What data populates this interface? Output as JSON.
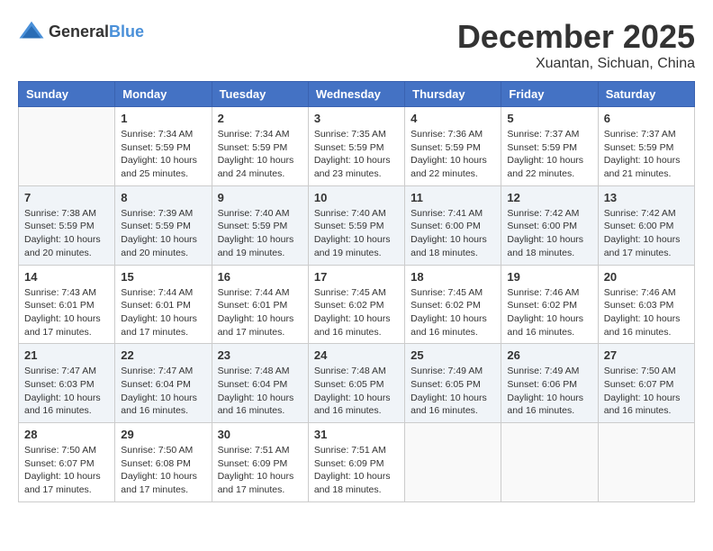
{
  "header": {
    "logo_general": "General",
    "logo_blue": "Blue",
    "month": "December 2025",
    "location": "Xuantan, Sichuan, China"
  },
  "weekdays": [
    "Sunday",
    "Monday",
    "Tuesday",
    "Wednesday",
    "Thursday",
    "Friday",
    "Saturday"
  ],
  "weeks": [
    [
      {
        "day": "",
        "info": ""
      },
      {
        "day": "1",
        "info": "Sunrise: 7:34 AM\nSunset: 5:59 PM\nDaylight: 10 hours\nand 25 minutes."
      },
      {
        "day": "2",
        "info": "Sunrise: 7:34 AM\nSunset: 5:59 PM\nDaylight: 10 hours\nand 24 minutes."
      },
      {
        "day": "3",
        "info": "Sunrise: 7:35 AM\nSunset: 5:59 PM\nDaylight: 10 hours\nand 23 minutes."
      },
      {
        "day": "4",
        "info": "Sunrise: 7:36 AM\nSunset: 5:59 PM\nDaylight: 10 hours\nand 22 minutes."
      },
      {
        "day": "5",
        "info": "Sunrise: 7:37 AM\nSunset: 5:59 PM\nDaylight: 10 hours\nand 22 minutes."
      },
      {
        "day": "6",
        "info": "Sunrise: 7:37 AM\nSunset: 5:59 PM\nDaylight: 10 hours\nand 21 minutes."
      }
    ],
    [
      {
        "day": "7",
        "info": "Sunrise: 7:38 AM\nSunset: 5:59 PM\nDaylight: 10 hours\nand 20 minutes."
      },
      {
        "day": "8",
        "info": "Sunrise: 7:39 AM\nSunset: 5:59 PM\nDaylight: 10 hours\nand 20 minutes."
      },
      {
        "day": "9",
        "info": "Sunrise: 7:40 AM\nSunset: 5:59 PM\nDaylight: 10 hours\nand 19 minutes."
      },
      {
        "day": "10",
        "info": "Sunrise: 7:40 AM\nSunset: 5:59 PM\nDaylight: 10 hours\nand 19 minutes."
      },
      {
        "day": "11",
        "info": "Sunrise: 7:41 AM\nSunset: 6:00 PM\nDaylight: 10 hours\nand 18 minutes."
      },
      {
        "day": "12",
        "info": "Sunrise: 7:42 AM\nSunset: 6:00 PM\nDaylight: 10 hours\nand 18 minutes."
      },
      {
        "day": "13",
        "info": "Sunrise: 7:42 AM\nSunset: 6:00 PM\nDaylight: 10 hours\nand 17 minutes."
      }
    ],
    [
      {
        "day": "14",
        "info": "Sunrise: 7:43 AM\nSunset: 6:01 PM\nDaylight: 10 hours\nand 17 minutes."
      },
      {
        "day": "15",
        "info": "Sunrise: 7:44 AM\nSunset: 6:01 PM\nDaylight: 10 hours\nand 17 minutes."
      },
      {
        "day": "16",
        "info": "Sunrise: 7:44 AM\nSunset: 6:01 PM\nDaylight: 10 hours\nand 17 minutes."
      },
      {
        "day": "17",
        "info": "Sunrise: 7:45 AM\nSunset: 6:02 PM\nDaylight: 10 hours\nand 16 minutes."
      },
      {
        "day": "18",
        "info": "Sunrise: 7:45 AM\nSunset: 6:02 PM\nDaylight: 10 hours\nand 16 minutes."
      },
      {
        "day": "19",
        "info": "Sunrise: 7:46 AM\nSunset: 6:02 PM\nDaylight: 10 hours\nand 16 minutes."
      },
      {
        "day": "20",
        "info": "Sunrise: 7:46 AM\nSunset: 6:03 PM\nDaylight: 10 hours\nand 16 minutes."
      }
    ],
    [
      {
        "day": "21",
        "info": "Sunrise: 7:47 AM\nSunset: 6:03 PM\nDaylight: 10 hours\nand 16 minutes."
      },
      {
        "day": "22",
        "info": "Sunrise: 7:47 AM\nSunset: 6:04 PM\nDaylight: 10 hours\nand 16 minutes."
      },
      {
        "day": "23",
        "info": "Sunrise: 7:48 AM\nSunset: 6:04 PM\nDaylight: 10 hours\nand 16 minutes."
      },
      {
        "day": "24",
        "info": "Sunrise: 7:48 AM\nSunset: 6:05 PM\nDaylight: 10 hours\nand 16 minutes."
      },
      {
        "day": "25",
        "info": "Sunrise: 7:49 AM\nSunset: 6:05 PM\nDaylight: 10 hours\nand 16 minutes."
      },
      {
        "day": "26",
        "info": "Sunrise: 7:49 AM\nSunset: 6:06 PM\nDaylight: 10 hours\nand 16 minutes."
      },
      {
        "day": "27",
        "info": "Sunrise: 7:50 AM\nSunset: 6:07 PM\nDaylight: 10 hours\nand 16 minutes."
      }
    ],
    [
      {
        "day": "28",
        "info": "Sunrise: 7:50 AM\nSunset: 6:07 PM\nDaylight: 10 hours\nand 17 minutes."
      },
      {
        "day": "29",
        "info": "Sunrise: 7:50 AM\nSunset: 6:08 PM\nDaylight: 10 hours\nand 17 minutes."
      },
      {
        "day": "30",
        "info": "Sunrise: 7:51 AM\nSunset: 6:09 PM\nDaylight: 10 hours\nand 17 minutes."
      },
      {
        "day": "31",
        "info": "Sunrise: 7:51 AM\nSunset: 6:09 PM\nDaylight: 10 hours\nand 18 minutes."
      },
      {
        "day": "",
        "info": ""
      },
      {
        "day": "",
        "info": ""
      },
      {
        "day": "",
        "info": ""
      }
    ]
  ]
}
